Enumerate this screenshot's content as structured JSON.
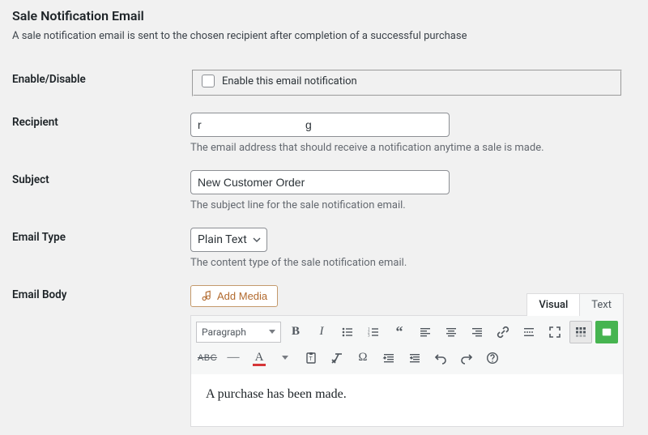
{
  "page": {
    "title": "Sale Notification Email",
    "description": "A sale notification email is sent to the chosen recipient after completion of a successful purchase"
  },
  "fields": {
    "enable": {
      "label": "Enable/Disable",
      "checkbox_label": "Enable this email notification"
    },
    "recipient": {
      "label": "Recipient",
      "value": "r                                 g",
      "help": "The email address that should receive a notification anytime a sale is made."
    },
    "subject": {
      "label": "Subject",
      "value": "New Customer Order",
      "help": "The subject line for the sale notification email."
    },
    "email_type": {
      "label": "Email Type",
      "selected": "Plain Text",
      "help": "The content type of the sale notification email."
    },
    "body": {
      "label": "Email Body"
    }
  },
  "editor": {
    "add_media": "Add Media",
    "tabs": {
      "visual": "Visual",
      "text": "Text"
    },
    "format_selector": "Paragraph",
    "content_line1": "A purchase has been made."
  }
}
